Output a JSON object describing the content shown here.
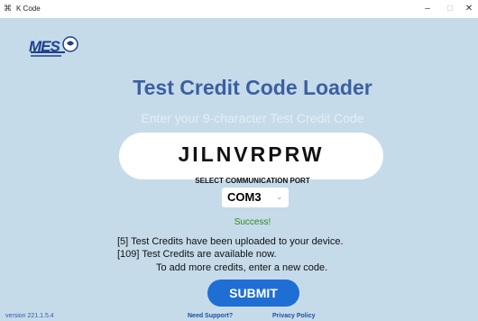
{
  "window": {
    "title": "K Code",
    "minimize_glyph": "–",
    "maximize_glyph": "□",
    "close_glyph": "✕"
  },
  "logo": {
    "text": "MES"
  },
  "header": {
    "title": "Test Credit Code Loader",
    "subtitle": "Enter your 9-character Test Credit Code"
  },
  "code_input": {
    "value": "JILNVRPRW"
  },
  "port": {
    "label": "SELECT COMMUNICATION PORT",
    "selected": "COM3"
  },
  "status": {
    "result": "Success!",
    "line1": "[5] Test Credits have been uploaded to your device.",
    "line2": "[109] Test Credits are available now.",
    "line3": "To add more credits, enter a new code."
  },
  "actions": {
    "submit_label": "SUBMIT"
  },
  "footer": {
    "version": "version 221.1.5.4",
    "support_link": "Need Support?",
    "privacy_link": "Privacy Policy"
  },
  "colors": {
    "background": "#c5dbea",
    "title": "#3b5fa2",
    "submit": "#1f6ed4",
    "success": "#2a8a1e"
  }
}
